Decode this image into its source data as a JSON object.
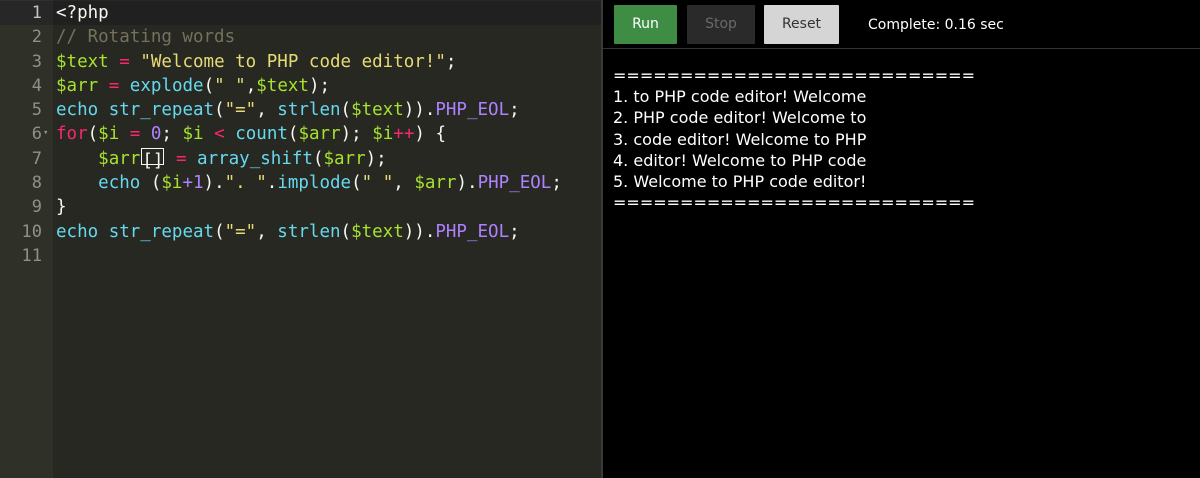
{
  "editor": {
    "lines": [
      {
        "num": "1",
        "tokens": [
          {
            "t": "<?php",
            "c": "txt"
          }
        ]
      },
      {
        "num": "2",
        "tokens": [
          {
            "t": "// Rotating words",
            "c": "cm"
          }
        ]
      },
      {
        "num": "3",
        "tokens": [
          {
            "t": "$text",
            "c": "var"
          },
          {
            "t": " ",
            "c": "txt"
          },
          {
            "t": "=",
            "c": "op"
          },
          {
            "t": " ",
            "c": "txt"
          },
          {
            "t": "\"Welcome to PHP code editor!\"",
            "c": "str"
          },
          {
            "t": ";",
            "c": "txt"
          }
        ]
      },
      {
        "num": "4",
        "tokens": [
          {
            "t": "$arr",
            "c": "var"
          },
          {
            "t": " ",
            "c": "txt"
          },
          {
            "t": "=",
            "c": "op"
          },
          {
            "t": " ",
            "c": "txt"
          },
          {
            "t": "explode",
            "c": "fn"
          },
          {
            "t": "(",
            "c": "txt"
          },
          {
            "t": "\" \"",
            "c": "str"
          },
          {
            "t": ",",
            "c": "txt"
          },
          {
            "t": "$text",
            "c": "var"
          },
          {
            "t": ");",
            "c": "txt"
          }
        ]
      },
      {
        "num": "5",
        "tokens": [
          {
            "t": "echo",
            "c": "fn"
          },
          {
            "t": " ",
            "c": "txt"
          },
          {
            "t": "str_repeat",
            "c": "fn"
          },
          {
            "t": "(",
            "c": "txt"
          },
          {
            "t": "\"=\"",
            "c": "str"
          },
          {
            "t": ", ",
            "c": "txt"
          },
          {
            "t": "strlen",
            "c": "fn"
          },
          {
            "t": "(",
            "c": "txt"
          },
          {
            "t": "$text",
            "c": "var"
          },
          {
            "t": ")).",
            "c": "txt"
          },
          {
            "t": "PHP_EOL",
            "c": "const"
          },
          {
            "t": ";",
            "c": "txt"
          }
        ]
      },
      {
        "num": "6",
        "fold": "▾",
        "tokens": [
          {
            "t": "for",
            "c": "op"
          },
          {
            "t": "(",
            "c": "txt"
          },
          {
            "t": "$i",
            "c": "var"
          },
          {
            "t": " ",
            "c": "txt"
          },
          {
            "t": "=",
            "c": "op"
          },
          {
            "t": " ",
            "c": "txt"
          },
          {
            "t": "0",
            "c": "const"
          },
          {
            "t": "; ",
            "c": "txt"
          },
          {
            "t": "$i",
            "c": "var"
          },
          {
            "t": " ",
            "c": "txt"
          },
          {
            "t": "<",
            "c": "op"
          },
          {
            "t": " ",
            "c": "txt"
          },
          {
            "t": "count",
            "c": "fn"
          },
          {
            "t": "(",
            "c": "txt"
          },
          {
            "t": "$arr",
            "c": "var"
          },
          {
            "t": "); ",
            "c": "txt"
          },
          {
            "t": "$i",
            "c": "var"
          },
          {
            "t": "++",
            "c": "op"
          },
          {
            "t": ") {",
            "c": "txt"
          }
        ]
      },
      {
        "num": "7",
        "tokens": [
          {
            "t": "    ",
            "c": "txt"
          },
          {
            "t": "$arr",
            "c": "var"
          },
          {
            "t": "[]",
            "c": "bracket"
          },
          {
            "t": " ",
            "c": "txt"
          },
          {
            "t": "=",
            "c": "op"
          },
          {
            "t": " ",
            "c": "txt"
          },
          {
            "t": "array_shift",
            "c": "fn"
          },
          {
            "t": "(",
            "c": "txt"
          },
          {
            "t": "$arr",
            "c": "var"
          },
          {
            "t": ");",
            "c": "txt"
          }
        ]
      },
      {
        "num": "8",
        "tokens": [
          {
            "t": "    ",
            "c": "txt"
          },
          {
            "t": "echo",
            "c": "fn"
          },
          {
            "t": " (",
            "c": "txt"
          },
          {
            "t": "$i",
            "c": "var"
          },
          {
            "t": "+1",
            "c": "const"
          },
          {
            "t": ").",
            "c": "txt"
          },
          {
            "t": "\". \"",
            "c": "str"
          },
          {
            "t": ".",
            "c": "txt"
          },
          {
            "t": "implode",
            "c": "fn"
          },
          {
            "t": "(",
            "c": "txt"
          },
          {
            "t": "\" \"",
            "c": "str"
          },
          {
            "t": ", ",
            "c": "txt"
          },
          {
            "t": "$arr",
            "c": "var"
          },
          {
            "t": ").",
            "c": "txt"
          },
          {
            "t": "PHP_EOL",
            "c": "const"
          },
          {
            "t": ";",
            "c": "txt"
          }
        ]
      },
      {
        "num": "9",
        "tokens": [
          {
            "t": "}",
            "c": "txt"
          }
        ]
      },
      {
        "num": "10",
        "tokens": [
          {
            "t": "echo",
            "c": "fn"
          },
          {
            "t": " ",
            "c": "txt"
          },
          {
            "t": "str_repeat",
            "c": "fn"
          },
          {
            "t": "(",
            "c": "txt"
          },
          {
            "t": "\"=\"",
            "c": "str"
          },
          {
            "t": ", ",
            "c": "txt"
          },
          {
            "t": "strlen",
            "c": "fn"
          },
          {
            "t": "(",
            "c": "txt"
          },
          {
            "t": "$text",
            "c": "var"
          },
          {
            "t": ")).",
            "c": "txt"
          },
          {
            "t": "PHP_EOL",
            "c": "const"
          },
          {
            "t": ";",
            "c": "txt"
          }
        ]
      },
      {
        "num": "11",
        "tokens": []
      }
    ],
    "active_line": 1,
    "colors": {
      "background": "#272822",
      "gutter": "#2f3129",
      "variable": "#a6e22e",
      "operator": "#f92672",
      "string": "#e6db74",
      "function": "#66d9ef",
      "constant": "#ae81ff",
      "comment": "#75715e"
    }
  },
  "toolbar": {
    "run_label": "Run",
    "stop_label": "Stop",
    "reset_label": "Reset",
    "status": "Complete: 0.16 sec",
    "colors": {
      "run": "#3f8c45",
      "stop": "#2a2a2a",
      "reset": "#d5d5d5"
    }
  },
  "output": {
    "lines": [
      "===========================",
      "1. to PHP code editor! Welcome",
      "2. PHP code editor! Welcome to",
      "3. code editor! Welcome to PHP",
      "4. editor! Welcome to PHP code",
      "5. Welcome to PHP code editor!",
      "==========================="
    ]
  }
}
